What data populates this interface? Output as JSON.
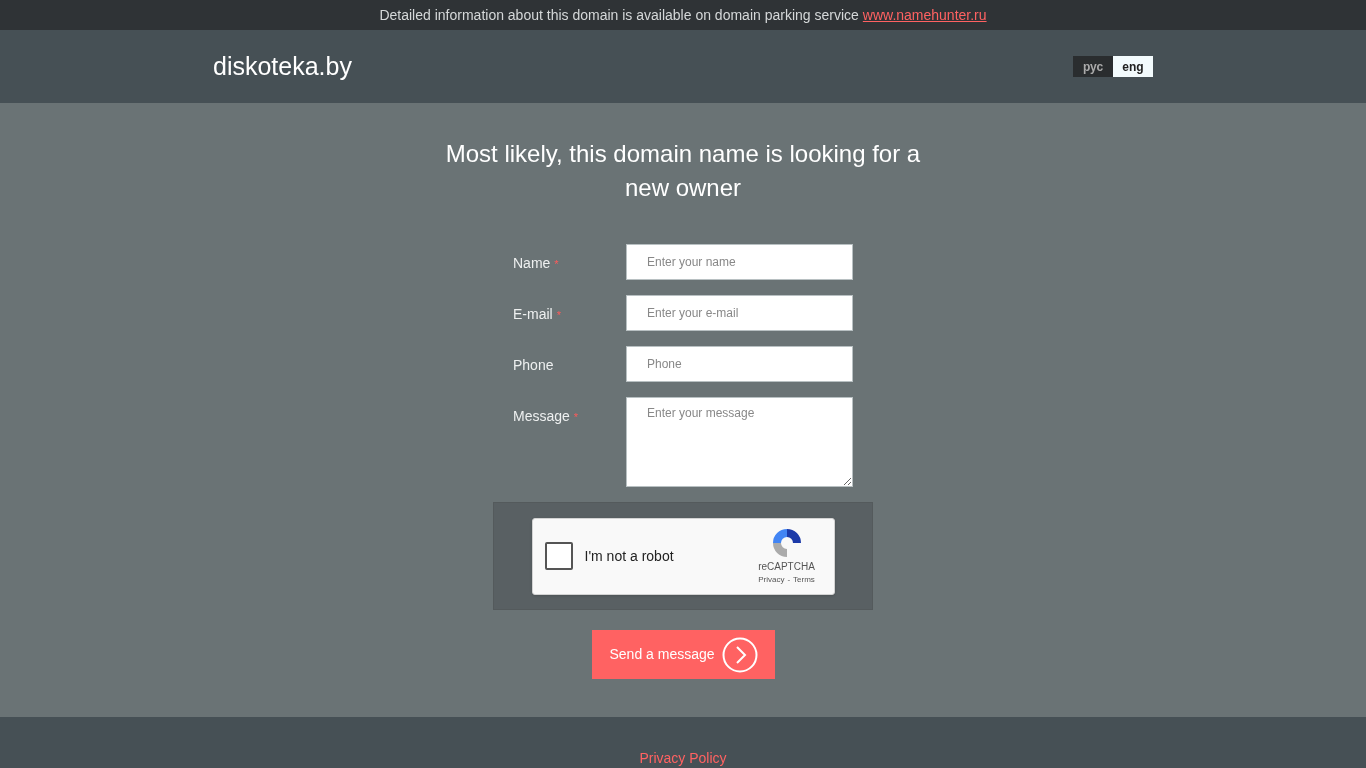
{
  "notice": {
    "text": "Detailed information about this domain is available on domain parking service",
    "link": "www.namehunter.ru"
  },
  "header": {
    "logo": "diskoteka.by",
    "languages": [
      {
        "label": "рус",
        "selected": false
      },
      {
        "label": "eng",
        "selected": true
      }
    ]
  },
  "heading": "Most likely, this domain name is looking for a new owner",
  "form": {
    "fields": [
      {
        "kind": "input",
        "label": "Name",
        "required_mark": "*",
        "placeholder": "Enter your name"
      },
      {
        "kind": "input",
        "label": "E-mail",
        "required_mark": "*",
        "placeholder": "Enter your e-mail"
      },
      {
        "kind": "input",
        "label": "Phone",
        "placeholder": "Phone"
      },
      {
        "kind": "textarea",
        "label": "Message",
        "required_mark": "*",
        "placeholder": "Enter your message"
      }
    ],
    "captcha": {
      "label": "I'm not a robot",
      "checked": false,
      "brand": "reCAPTCHA",
      "privacy": "Privacy",
      "separator": "-",
      "terms": "Terms"
    },
    "submit": "Send a message"
  },
  "footer": {
    "link": "Privacy Policy"
  }
}
